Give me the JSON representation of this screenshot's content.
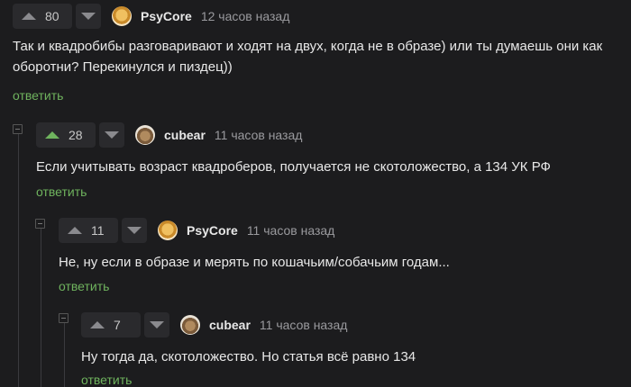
{
  "comments": [
    {
      "score": "80",
      "author": "PsyCore",
      "time": "12 часов назад",
      "text": "Так и квадробибы разговаривают и ходят на двух, когда не в образе) или ты думаешь они как оборотни? Перекинулся и пиздец))",
      "reply": "ответить",
      "avatar": "psycore-avatar"
    },
    {
      "score": "28",
      "author": "cubear",
      "time": "11 часов назад",
      "text": "Если учитывать возраст квадроберов, получается не скотоложество, а 134 УК РФ",
      "reply": "ответить",
      "avatar": "cubear-avatar",
      "upvoted": true
    },
    {
      "score": "11",
      "author": "PsyCore",
      "time": "11 часов назад",
      "text": "Не, ну если в образе и мерять по кошачьим/собачьим годам...",
      "reply": "ответить",
      "avatar": "psycore-avatar"
    },
    {
      "score": "7",
      "author": "cubear",
      "time": "11 часов назад",
      "text": "Ну тогда да, скотоложество. Но статья всё равно 134",
      "reply": "ответить",
      "avatar": "cubear-avatar"
    }
  ],
  "colors": {
    "background": "#1c1c1e",
    "accent_green": "#6fb35e",
    "muted": "#9a9a9e"
  }
}
